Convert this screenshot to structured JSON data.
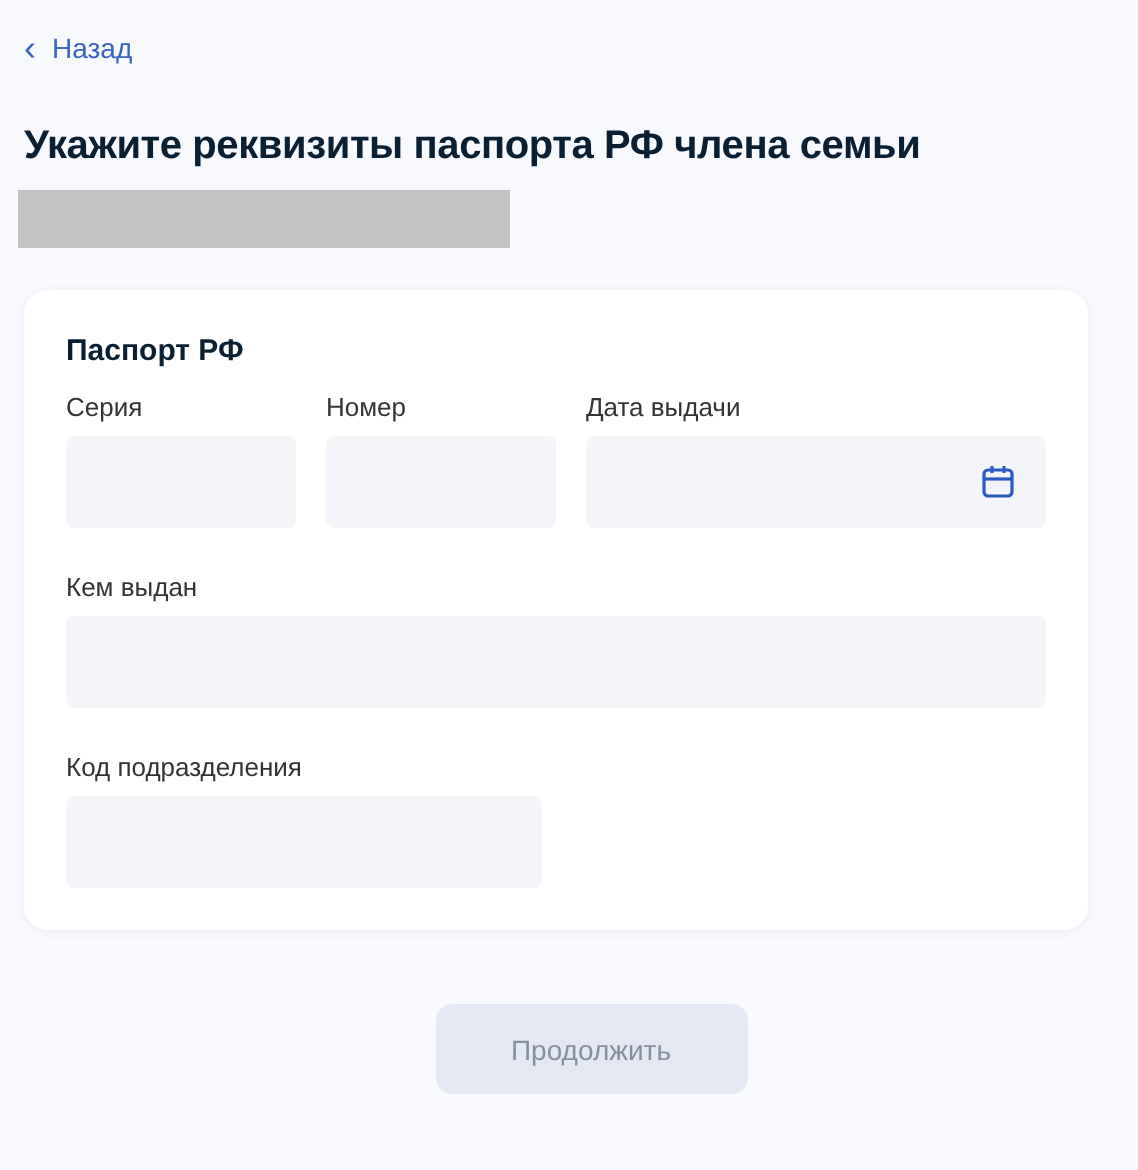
{
  "back_link": {
    "icon": "‹",
    "label": "Назад"
  },
  "title": "Укажите реквизиты паспорта РФ члена семьи",
  "form": {
    "title": "Паспорт РФ",
    "rows": [
      [
        {
          "label": "Серия",
          "kind": "text"
        },
        {
          "label": "Номер",
          "kind": "text"
        },
        {
          "label": "Дата выдачи",
          "kind": "date"
        }
      ],
      [
        {
          "label": "Кем выдан",
          "kind": "text"
        }
      ],
      [
        {
          "label": "Код подразделения",
          "kind": "text"
        }
      ]
    ]
  },
  "continue_button": {
    "label": "Продолжить",
    "disabled": true
  }
}
